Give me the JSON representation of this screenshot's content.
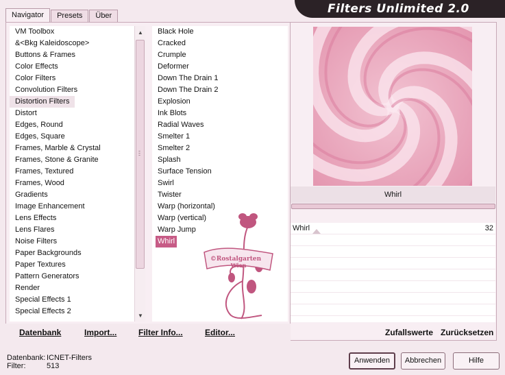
{
  "window": {
    "title": "Filters Unlimited 2.0"
  },
  "tabs": [
    {
      "label": "Navigator",
      "active": true
    },
    {
      "label": "Presets",
      "active": false
    },
    {
      "label": "Über",
      "active": false
    }
  ],
  "categories": [
    "VM Toolbox",
    "&<Bkg Kaleidoscope>",
    "Buttons & Frames",
    "Color Effects",
    "Color Filters",
    "Convolution Filters",
    "Distortion Filters",
    "Distort",
    "Edges, Round",
    "Edges, Square",
    "Frames, Marble & Crystal",
    "Frames, Stone & Granite",
    "Frames, Textured",
    "Frames, Wood",
    "Gradients",
    "Image Enhancement",
    "Lens Effects",
    "Lens Flares",
    "Noise Filters",
    "Paper Backgrounds",
    "Paper Textures",
    "Pattern Generators",
    "Render",
    "Special Effects 1",
    "Special Effects 2"
  ],
  "selected_category_index": 6,
  "filters": [
    "Black Hole",
    "Cracked",
    "Crumple",
    "Deformer",
    "Down The Drain 1",
    "Down The Drain 2",
    "Explosion",
    "Ink Blots",
    "Radial Waves",
    "Smelter 1",
    "Smelter 2",
    "Splash",
    "Surface Tension",
    "Swirl",
    "Twister",
    "Warp (horizontal)",
    "Warp (vertical)",
    "Warp Jump",
    "Whirl"
  ],
  "selected_filter_index": 18,
  "toolbar": {
    "database": "Datenbank",
    "import": "Import...",
    "filter_info": "Filter Info...",
    "editor": "Editor...",
    "random": "Zufallswerte",
    "reset": "Zurücksetzen"
  },
  "preview": {
    "filter_name": "Whirl"
  },
  "parameters": [
    {
      "label": "Whirl",
      "value": "32"
    }
  ],
  "status": {
    "db_label": "Datenbank:",
    "db_value": "ICNET-Filters",
    "filter_label": "Filter:",
    "filter_value": "513"
  },
  "buttons": {
    "apply": "Anwenden",
    "cancel": "Abbrechen",
    "help": "Hilfe"
  },
  "watermark": {
    "line1": "©Rostalgarten",
    "line2": "Wien"
  },
  "colors": {
    "accent": "#c75b86",
    "banner": "#2b2226",
    "background": "#f4e9ee"
  }
}
